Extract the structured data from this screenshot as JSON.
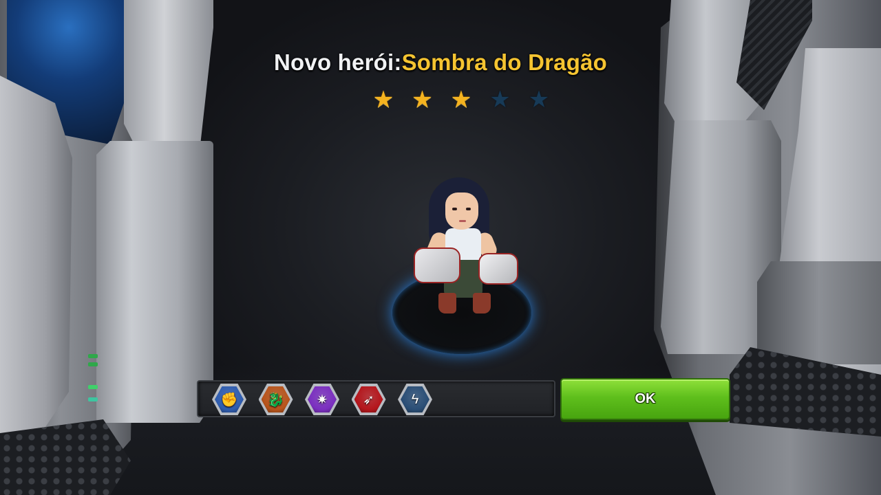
{
  "header": {
    "prefix": "Novo herói:",
    "hero_name": "Sombra do Dragão"
  },
  "rating": {
    "stars_filled": 3,
    "stars_total": 5
  },
  "skills": [
    {
      "icon": "fist-icon",
      "glyph": "✊",
      "color": "#2f5db0"
    },
    {
      "icon": "dragon-icon",
      "glyph": "🐉",
      "color": "#b8541b"
    },
    {
      "icon": "energy-burst-icon",
      "glyph": "✷",
      "color": "#7b2fc0"
    },
    {
      "icon": "flying-kick-icon",
      "glyph": "➶",
      "color": "#b5161c"
    },
    {
      "icon": "lightning-icon",
      "glyph": "ϟ",
      "color": "#2a4e76"
    }
  ],
  "actions": {
    "ok_label": "OK"
  },
  "colors": {
    "title_name": "#f5c431",
    "button_green": "#5fbf1c",
    "star_gold": "#f5b31f",
    "star_empty": "#173a57",
    "pedestal_glow": "#2f7fd6"
  }
}
